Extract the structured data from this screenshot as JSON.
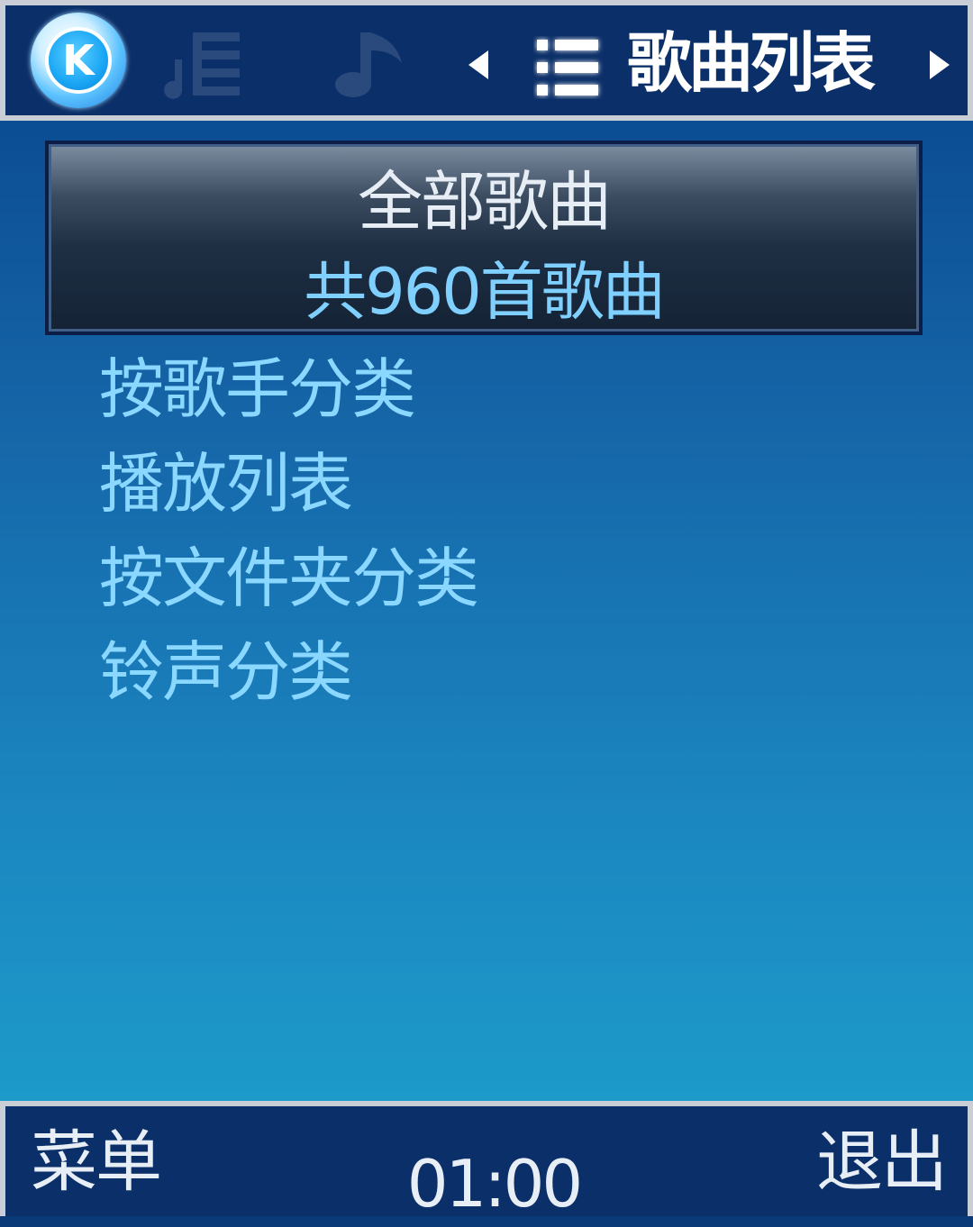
{
  "header": {
    "logo_letter": "K",
    "title": "歌曲列表",
    "icons": [
      "lyrics-icon",
      "music-note-icon",
      "list-icon"
    ]
  },
  "card": {
    "title": "全部歌曲",
    "subtitle": "共960首歌曲"
  },
  "menu": {
    "items": [
      {
        "label": "按歌手分类"
      },
      {
        "label": "播放列表"
      },
      {
        "label": "按文件夹分类"
      },
      {
        "label": "铃声分类"
      }
    ]
  },
  "footer": {
    "left_softkey": "菜单",
    "time": "01:00",
    "right_softkey": "退出"
  },
  "colors": {
    "bar_bg": "#0b2f68",
    "menu_text": "#8ad7ff",
    "subtitle_text": "#7fd0ff"
  }
}
